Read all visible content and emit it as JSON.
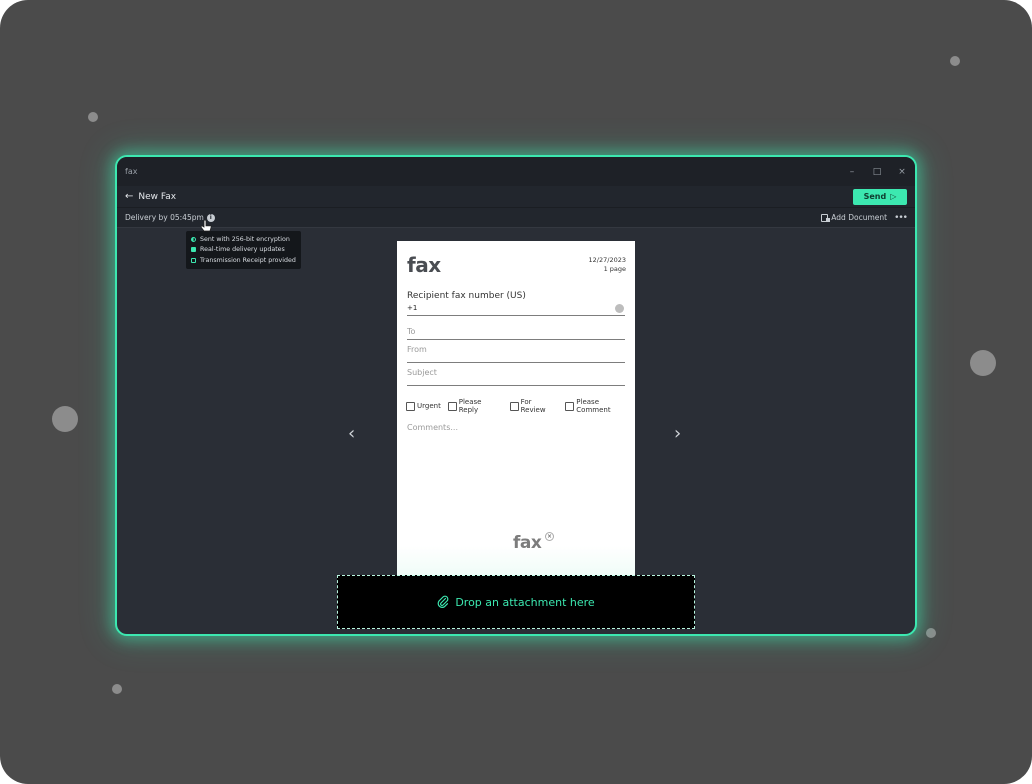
{
  "app": {
    "title": "fax"
  },
  "window_controls": {
    "minimize": "–",
    "maximize": "□",
    "close": "×"
  },
  "header": {
    "back_label": "New Fax",
    "send_label": "Send"
  },
  "subbar": {
    "delivery_text": "Delivery by 05:45pm",
    "add_document_label": "Add Document",
    "more_label": "•••"
  },
  "tooltip": {
    "items": [
      "Sent with 256-bit encryption",
      "Real-time delivery updates",
      "Transmission Receipt provided"
    ]
  },
  "document": {
    "logo": "fax",
    "date": "12/27/2023",
    "pages": "1 page",
    "recipient_label": "Recipient fax number (US)",
    "recipient_value": "+1",
    "to_placeholder": "To",
    "from_placeholder": "From",
    "subject_placeholder": "Subject",
    "checkboxes": [
      "Urgent",
      "Please Reply",
      "For Review",
      "Please Comment"
    ],
    "comments_placeholder": "Comments...",
    "footer_logo": "fax",
    "footer_close": "×"
  },
  "dropzone": {
    "label": "Drop an attachment here"
  },
  "colors": {
    "accent": "#3ce8b0",
    "window_bg": "#2a2e36",
    "stage_bg": "#4b4b4b"
  }
}
